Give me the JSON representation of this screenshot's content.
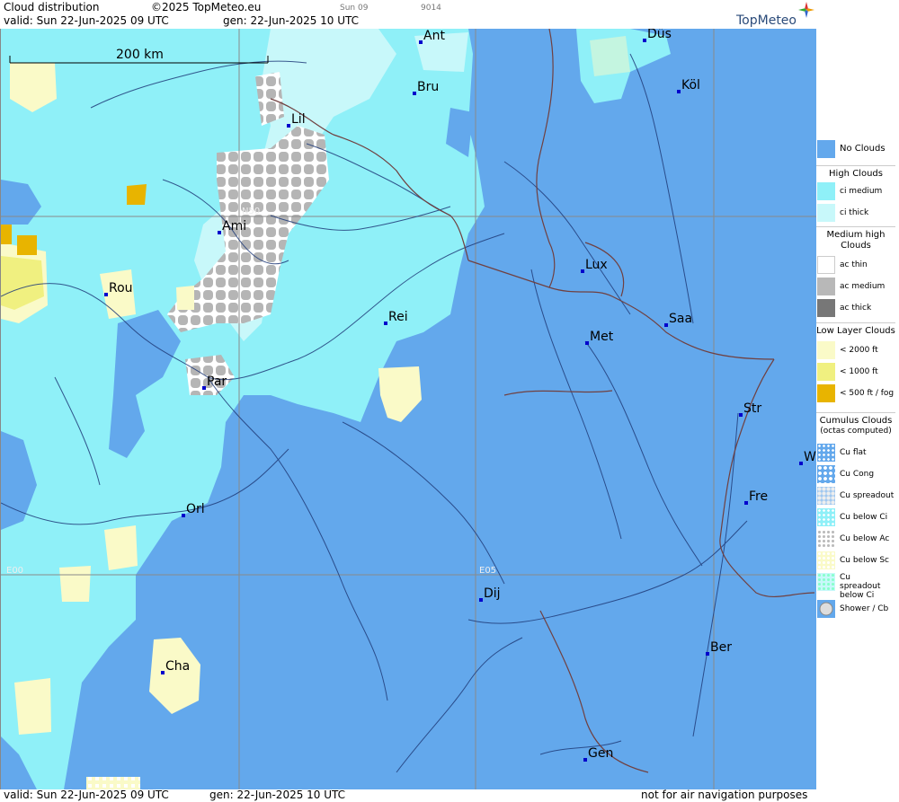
{
  "header": {
    "title": "Cloud distribution",
    "copyright": "©2025 TopMeteo.eu",
    "frame_label": "Sun 09",
    "frame_code": "9014",
    "valid": "valid:  Sun  22-Jun-2025  09 UTC",
    "generated": "gen: 22-Jun-2025 10 UTC",
    "logo": "TopMeteo"
  },
  "footer": {
    "valid": "valid:  Sun  22-Jun-2025  09 UTC",
    "generated": "gen: 22-Jun-2025 10 UTC",
    "disclaimer": "not for air navigation purposes"
  },
  "map": {
    "scale_label": "200 km",
    "grid_labels": {
      "lat": "N50",
      "lon0": "E00",
      "lon5": "E05"
    },
    "cities": [
      "Ant",
      "Düs",
      "Köl",
      "Bru",
      "Lil",
      "Ami",
      "Rou",
      "Lux",
      "Rei",
      "Saa",
      "Met",
      "Par",
      "Str",
      "W",
      "Fre",
      "Orl",
      "Dij",
      "Ber",
      "Cha",
      "Gen"
    ],
    "colors": {
      "no_clouds": "#63a8ec",
      "ci_medium": "#8ff0f8",
      "ci_thick": "#c8f8fa",
      "ac_thin": "#ffffff",
      "ac_medium": "#b8b8b8",
      "ac_thick": "#777777",
      "low_2000": "#fafac8",
      "low_1000": "#f0f080",
      "low_500": "#e8b400",
      "rivers": "#203c7a",
      "borders": "#704040"
    }
  },
  "legend": {
    "no_clouds": "No Clouds",
    "high_title": "High Clouds",
    "ci_medium": "ci medium",
    "ci_thick": "ci thick",
    "medium_title": "Medium high Clouds",
    "ac_thin": "ac thin",
    "ac_medium": "ac medium",
    "ac_thick": "ac thick",
    "low_title": "Low Layer Clouds",
    "low_2000": "< 2000 ft",
    "low_1000": "< 1000 ft",
    "low_500": "< 500 ft / fog",
    "cu_title": "Cumulus Clouds",
    "cu_subtitle": "(octas computed)",
    "cu_flat": "Cu flat",
    "cu_cong": "Cu Cong",
    "cu_spreadout": "Cu spreadout",
    "cu_below_ci": "Cu below Ci",
    "cu_below_ac": "Cu below Ac",
    "cu_below_sc": "Cu below Sc",
    "cu_spread_below_ci": "Cu spreadout below Ci",
    "shower": "Shower / Cb"
  }
}
